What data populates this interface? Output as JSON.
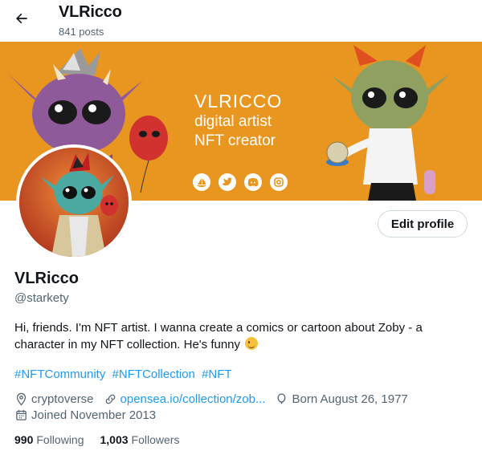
{
  "header": {
    "title": "VLRicco",
    "posts": "841 posts"
  },
  "banner": {
    "line1": "VLRICCO",
    "line2": "digital artist",
    "line3": "NFT creator",
    "social_icons": [
      "opensea-icon",
      "twitter-icon",
      "discord-icon",
      "instagram-icon"
    ]
  },
  "profile": {
    "edit_label": "Edit profile",
    "name": "VLRicco",
    "handle": "@starkety",
    "bio": "Hi, friends. I'm NFT artist. I wanna create a comics or cartoon about Zoby - a character in my NFT collection. He's funny",
    "hashtags": [
      "#NFTCommunity",
      "#NFTCollection",
      "#NFT"
    ],
    "location": "cryptoverse",
    "website": "opensea.io/collection/zob...",
    "birthday": "Born August 26, 1977",
    "joined": "Joined November 2013",
    "following_count": "990",
    "following_label": "Following",
    "followers_count": "1,003",
    "followers_label": "Followers"
  },
  "colors": {
    "banner": "#e8961f",
    "link": "#1d9bf0",
    "muted": "#536471"
  }
}
